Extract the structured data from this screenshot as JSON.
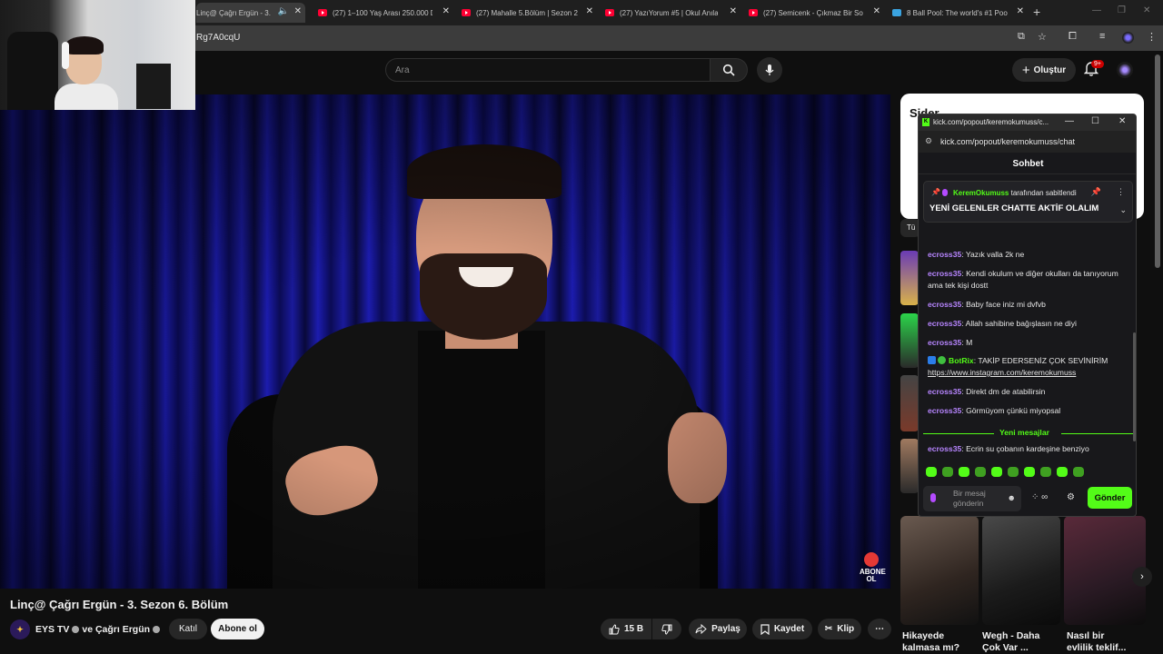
{
  "browser": {
    "tabs": [
      {
        "title": "Linç@ Çağrı Ergün - 3.",
        "active": true
      },
      {
        "title": "(27) 1–100 Yaş Arası 250.000 D"
      },
      {
        "title": "(27) Mahalle 5.Bölüm | Sezon 2"
      },
      {
        "title": "(27) YazıYorum #5 | Okul Anıları"
      },
      {
        "title": "(27) Semicenk - Çıkmaz Bir Sok"
      },
      {
        "title": "8 Ball Pool: The world's #1 Poo"
      }
    ],
    "url": "Rg7A0cqU"
  },
  "youtube": {
    "search_placeholder": "Ara",
    "create_label": "Oluştur",
    "notification_count": "9+",
    "video_title": "Linç@ Çağrı Ergün - 3. Sezon 6. Bölüm",
    "channel": "EYS TV",
    "collab": "ve Çağrı Ergün",
    "join_label": "Katıl",
    "subscribe_label": "Abone ol",
    "likes": "15 B",
    "share_label": "Paylaş",
    "save_label": "Kaydet",
    "clip_label": "Klip",
    "overlay_subscribe": "ABONE OL",
    "side_title": "Sider",
    "chip_label": "Tü",
    "shorts": [
      {
        "title": "Hikayede kalmasa mı?"
      },
      {
        "title": "Wegh - Daha Çok Var ..."
      },
      {
        "title": "Nasıl bir evlilik teklif..."
      }
    ]
  },
  "kick": {
    "window_title": "kick.com/popout/keremokumuss/c...",
    "url": "kick.com/popout/keremokumuss/chat",
    "header": "Sohbet",
    "pinned_by": "KeremOkumuss",
    "pinned_suffix": "tarafından sabitlendi",
    "pinned_message": "YENİ GELENLER CHATTE AKTİF OLALIM",
    "messages": [
      {
        "user": "ecross35",
        "text": "Yazık valla 2k ne"
      },
      {
        "user": "ecross35",
        "text": "Kendi okulum ve diğer okulları da tanıyorum ama tek kişi dostt"
      },
      {
        "user": "ecross35",
        "text": "Baby face iniz mi dvfvb"
      },
      {
        "user": "ecross35",
        "text": "Allah sahibine bağışlasın ne diyi"
      },
      {
        "user": "ecross35",
        "text": "M"
      },
      {
        "user": "BotRix",
        "text": "TAKİP EDERSENİZ ÇOK SEVİNİRİM",
        "link": "https://www.instagram.com/keremokumuss"
      },
      {
        "user": "ecross35",
        "text": "Direkt dm de atabilirsin"
      },
      {
        "user": "ecross35",
        "text": "Görmüyom çünkü miyopsal"
      },
      {
        "user": "ecross35",
        "text": "Ecrin su çobanın kardeşine benziyo"
      }
    ],
    "new_messages_label": "Yeni mesajlar",
    "input_placeholder": "Bir mesaj gönderin",
    "send_label": "Gönder"
  },
  "colors": {
    "kick_green": "#53fc18",
    "kick_username": "#b785ff",
    "youtube_red": "#ff0033"
  }
}
